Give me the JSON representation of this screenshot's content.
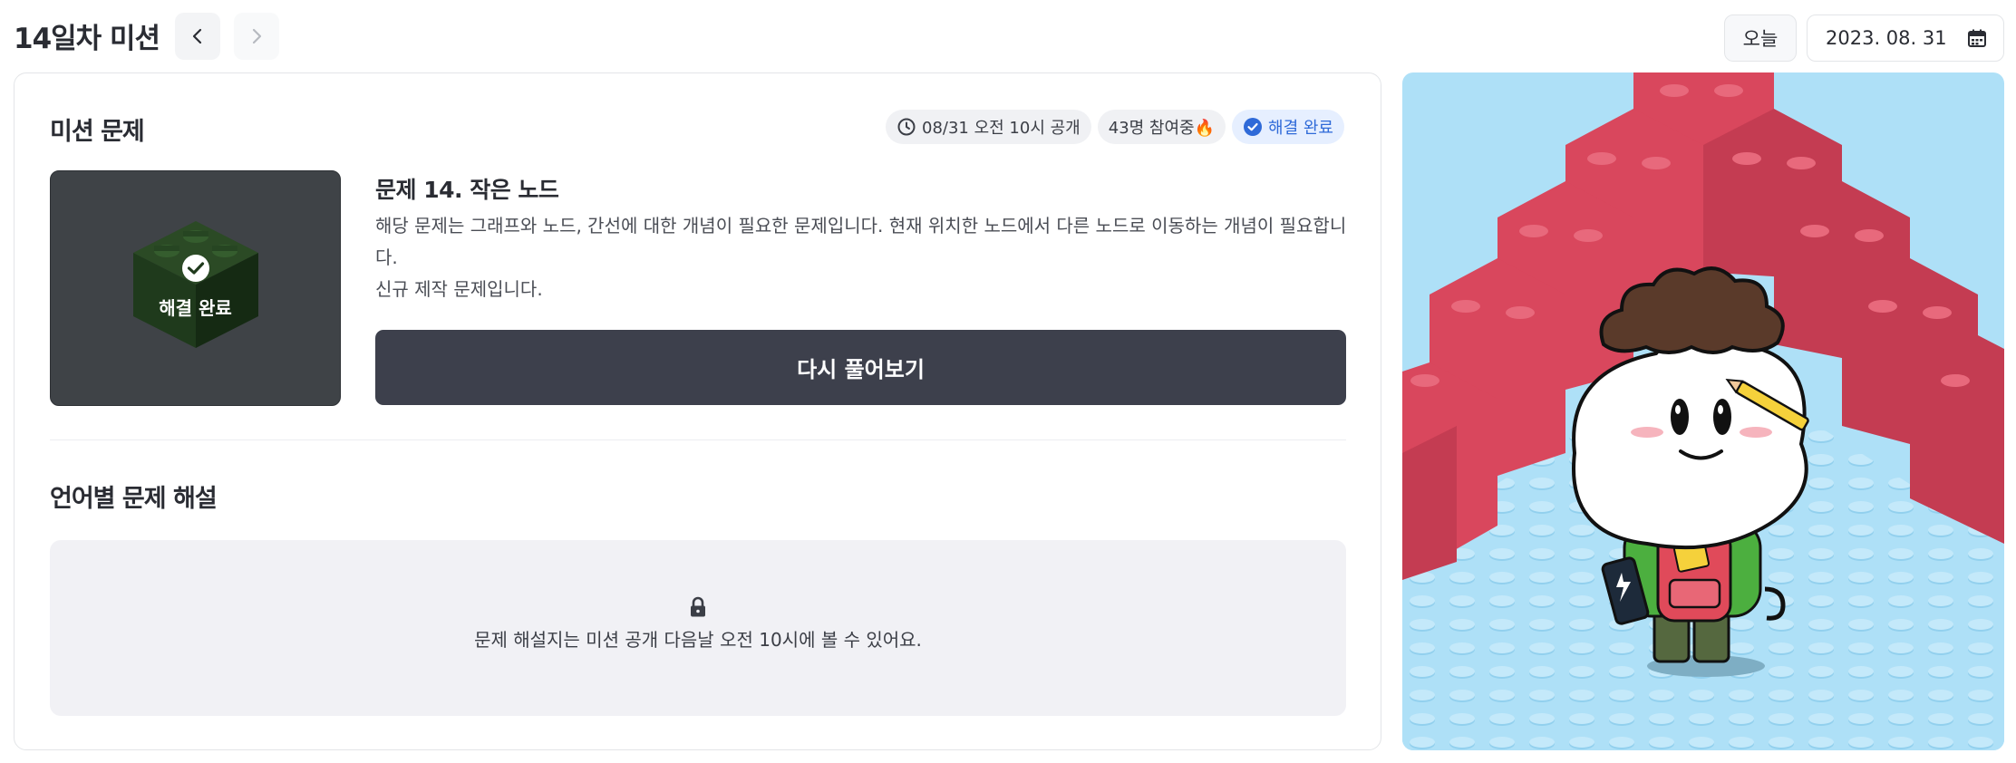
{
  "header": {
    "title": "14일차 미션",
    "today_label": "오늘",
    "date": "2023. 08. 31"
  },
  "mission": {
    "section_title": "미션 문제",
    "badges": {
      "release": "08/31 오전 10시 공개",
      "participants": "43명 참여중🔥",
      "status": "해결 완료"
    },
    "thumbnail_label": "해결 완료",
    "problem_title": "문제 14. 작은 노드",
    "description_lines": [
      "해당 문제는 그래프와 노드, 간선에 대한 개념이 필요한 문제입니다. 현재 위치한 노드에서 다른 노드로 이동하는 개념이 필요합니다.",
      "신규 제작 문제입니다."
    ],
    "retry_label": "다시 풀어보기"
  },
  "solution": {
    "section_title": "언어별 문제 해설",
    "locked_message": "문제 해설지는 미션 공개 다음날 오전 10시에 볼 수 있어요."
  },
  "colors": {
    "accent_blue": "#2f6ad8",
    "button_dark": "#3d404c",
    "lego_red": "#d9475d",
    "lego_green": "#1f3a1c",
    "sky": "#aee0f7"
  }
}
